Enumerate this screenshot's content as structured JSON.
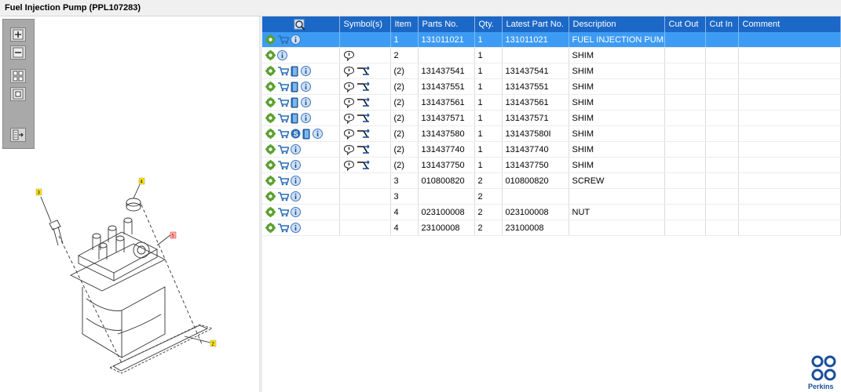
{
  "window": {
    "title": "Fuel Injection Pump (PPL107283)"
  },
  "toolbar": {
    "buttons": [
      "zoom-in",
      "zoom-out",
      "fit-all",
      "fit-window",
      "export"
    ]
  },
  "drawing": {
    "callouts": [
      "3",
      "4",
      "5",
      "2"
    ]
  },
  "table": {
    "headers": [
      "",
      "Symbol(s)",
      "Item",
      "Parts No.",
      "Qty.",
      "Latest Part No.",
      "Description",
      "Cut Out",
      "Cut In",
      "Comment"
    ],
    "rows": [
      {
        "icons": [
          "gear",
          "cart",
          "info"
        ],
        "symbols": [],
        "item": "1",
        "part": "131011021",
        "qty": "1",
        "latest": "131011021",
        "desc": "FUEL INJECTION PUMP",
        "selected": true
      },
      {
        "icons": [
          "gear",
          "info"
        ],
        "symbols": [
          "note"
        ],
        "item": "2",
        "part": "",
        "qty": "1",
        "latest": "",
        "desc": "SHIM"
      },
      {
        "icons": [
          "gear",
          "cart",
          "book",
          "info"
        ],
        "symbols": [
          "note",
          "link"
        ],
        "item": "(2)",
        "part": "131437541",
        "qty": "1",
        "latest": "131437541",
        "desc": "SHIM"
      },
      {
        "icons": [
          "gear",
          "cart",
          "book",
          "info"
        ],
        "symbols": [
          "note",
          "link"
        ],
        "item": "(2)",
        "part": "131437551",
        "qty": "1",
        "latest": "131437551",
        "desc": "SHIM"
      },
      {
        "icons": [
          "gear",
          "cart",
          "book",
          "info"
        ],
        "symbols": [
          "note",
          "link"
        ],
        "item": "(2)",
        "part": "131437561",
        "qty": "1",
        "latest": "131437561",
        "desc": "SHIM"
      },
      {
        "icons": [
          "gear",
          "cart",
          "book",
          "info"
        ],
        "symbols": [
          "note",
          "link"
        ],
        "item": "(2)",
        "part": "131437571",
        "qty": "1",
        "latest": "131437571",
        "desc": "SHIM"
      },
      {
        "icons": [
          "gear",
          "cart",
          "s",
          "book",
          "info"
        ],
        "symbols": [
          "note",
          "link"
        ],
        "item": "(2)",
        "part": "131437580",
        "qty": "1",
        "latest": "131437580I",
        "desc": "SHIM"
      },
      {
        "icons": [
          "gear",
          "cart",
          "info"
        ],
        "symbols": [
          "note",
          "link"
        ],
        "item": "(2)",
        "part": "131437740",
        "qty": "1",
        "latest": "131437740",
        "desc": "SHIM"
      },
      {
        "icons": [
          "gear",
          "cart",
          "info"
        ],
        "symbols": [
          "note",
          "link"
        ],
        "item": "(2)",
        "part": "131437750",
        "qty": "1",
        "latest": "131437750",
        "desc": "SHIM"
      },
      {
        "icons": [
          "gear",
          "cart",
          "info"
        ],
        "symbols": [],
        "item": "3",
        "part": "010800820",
        "qty": "2",
        "latest": "010800820",
        "desc": "SCREW"
      },
      {
        "icons": [
          "gear",
          "cart",
          "info"
        ],
        "symbols": [],
        "item": "3",
        "part": "",
        "qty": "2",
        "latest": "",
        "desc": ""
      },
      {
        "icons": [
          "gear",
          "cart",
          "info"
        ],
        "symbols": [],
        "item": "4",
        "part": "023100008",
        "qty": "2",
        "latest": "023100008",
        "desc": "NUT"
      },
      {
        "icons": [
          "gear",
          "cart",
          "info"
        ],
        "symbols": [],
        "item": "4",
        "part": "23100008",
        "qty": "2",
        "latest": "23100008",
        "desc": ""
      }
    ]
  },
  "brand": {
    "name": "Perkins",
    "color": "#1a4d9c"
  },
  "colors": {
    "header": "#1c68c6",
    "selected": "#3d9bf4",
    "gear": "#5aa02c",
    "cart": "#2d6fb6"
  }
}
